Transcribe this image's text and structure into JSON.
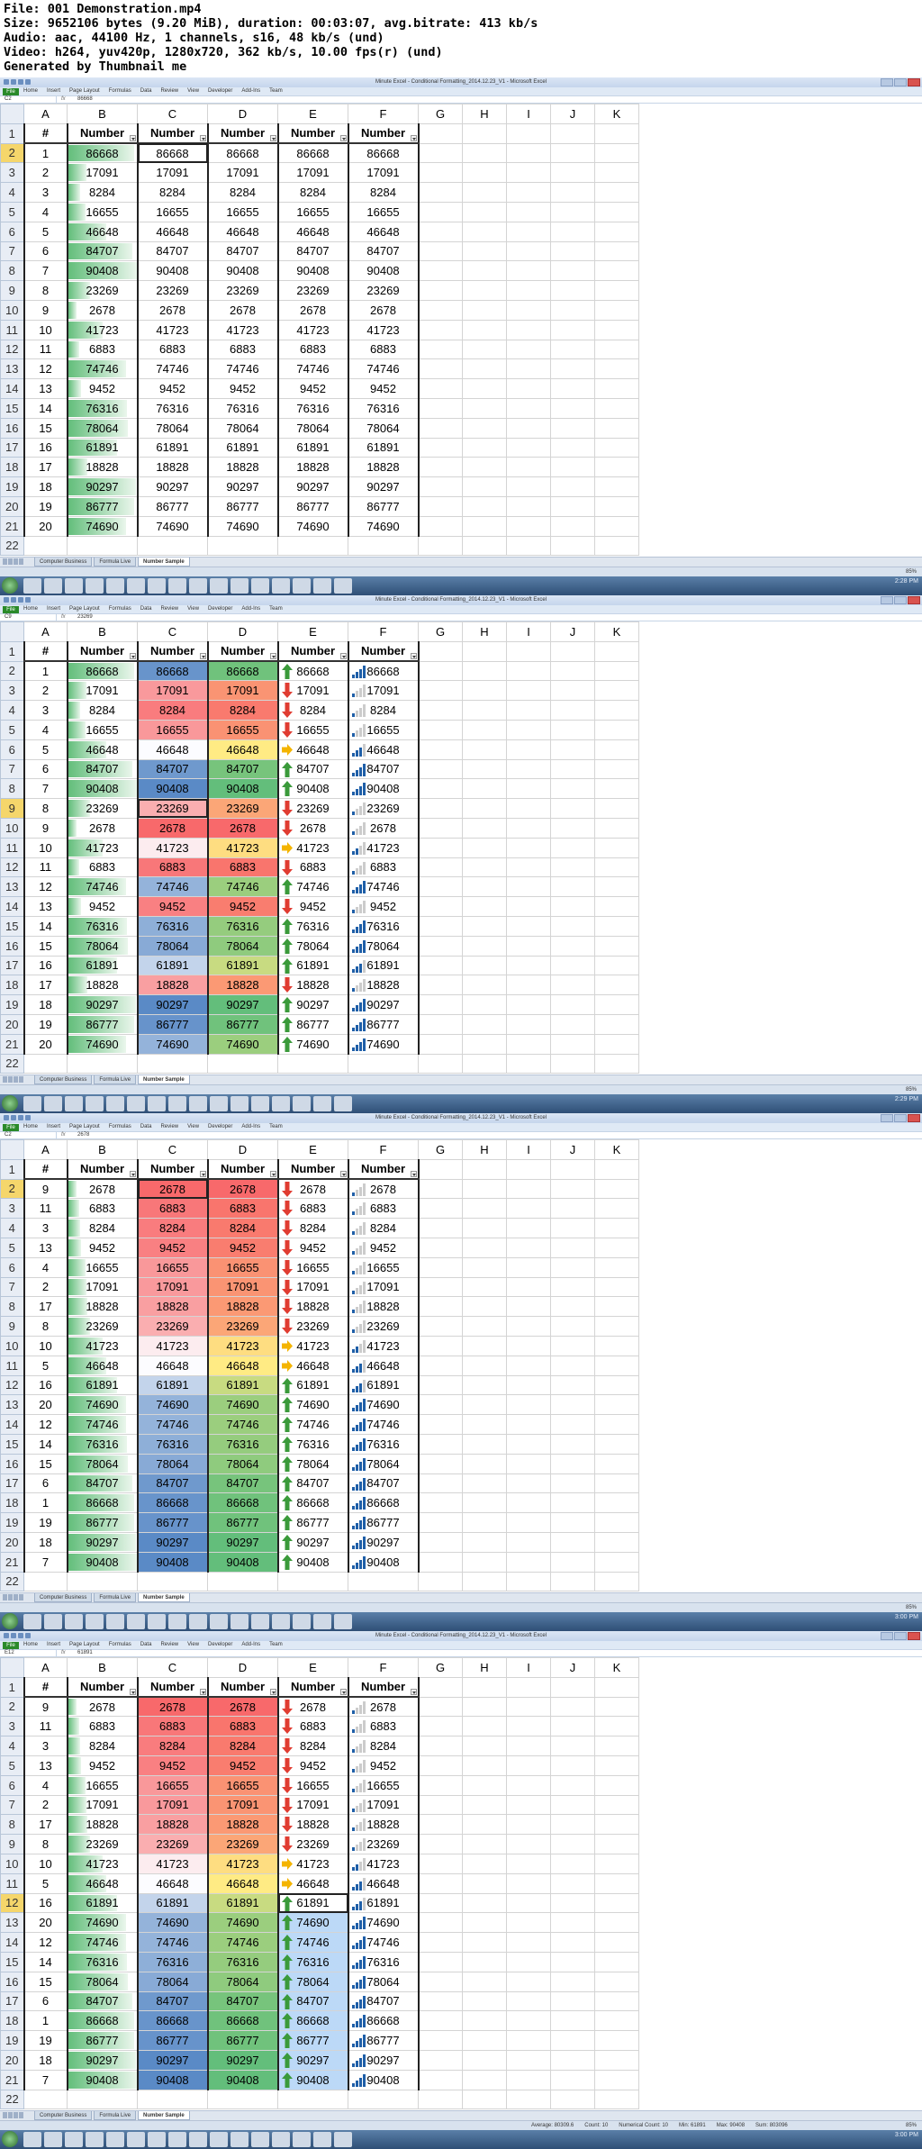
{
  "header": {
    "lines": [
      "File: 001 Demonstration.mp4",
      "Size: 9652106 bytes (9.20 MiB), duration: 00:03:07, avg.bitrate: 413 kb/s",
      "Audio: aac, 44100 Hz, 1 channels, s16, 48 kb/s (und)",
      "Video: h264, yuv420p, 1280x720, 362 kb/s, 10.00 fps(r) (und)",
      "Generated by Thumbnail me"
    ]
  },
  "common": {
    "window_title": "Minute Excel - Conditional Formatting_2014.12.23_V1 - Microsoft Excel",
    "file_tab": "File",
    "ribbon_tabs": [
      "Home",
      "Insert",
      "Page Layout",
      "Formulas",
      "Data",
      "Review",
      "View",
      "Developer",
      "Add-Ins",
      "Team"
    ],
    "fx": "fx",
    "column_letters": [
      "A",
      "B",
      "C",
      "D",
      "E",
      "F",
      "G",
      "H",
      "I",
      "J",
      "K"
    ],
    "row_numbers": [
      "1",
      "2",
      "3",
      "4",
      "5",
      "6",
      "7",
      "8",
      "9",
      "10",
      "11",
      "12",
      "13",
      "14",
      "15",
      "16",
      "17",
      "18",
      "19",
      "20",
      "21",
      "22"
    ],
    "header_hash": "#",
    "header_number": "Number",
    "sheet_tabs": [
      "Computer Business",
      "Formula Live",
      "Number Sample"
    ],
    "active_sheet": "Number Sample",
    "zoom": "85%",
    "colors": {
      "databar": "#63be7b",
      "scale_low": "#f8696b",
      "scale_mid": "#ffeb84",
      "scale_high": "#5a8ac6",
      "arrow_up": "#3a9a3a",
      "arrow_side": "#f4b400",
      "arrow_down": "#e03c31",
      "highlight": "#bcd9f7",
      "selected_header": "#f5d66b"
    }
  },
  "frames": [
    {
      "name_box": "C2",
      "formula": "86668",
      "mode": "plain",
      "active_col": "C",
      "active_row": 2,
      "time": "2:28 PM",
      "status": "",
      "rows": [
        [
          1,
          86668
        ],
        [
          2,
          17091
        ],
        [
          3,
          8284
        ],
        [
          4,
          16655
        ],
        [
          5,
          46648
        ],
        [
          6,
          84707
        ],
        [
          7,
          90408
        ],
        [
          8,
          23269
        ],
        [
          9,
          2678
        ],
        [
          10,
          41723
        ],
        [
          11,
          6883
        ],
        [
          12,
          74746
        ],
        [
          13,
          9452
        ],
        [
          14,
          76316
        ],
        [
          15,
          78064
        ],
        [
          16,
          61891
        ],
        [
          17,
          18828
        ],
        [
          18,
          90297
        ],
        [
          19,
          86777
        ],
        [
          20,
          74690
        ]
      ]
    },
    {
      "name_box": "C9",
      "formula": "23269",
      "mode": "formatted",
      "active_col": "C",
      "active_row": 9,
      "time": "2:29 PM",
      "status": "",
      "rows": [
        [
          1,
          86668
        ],
        [
          2,
          17091
        ],
        [
          3,
          8284
        ],
        [
          4,
          16655
        ],
        [
          5,
          46648
        ],
        [
          6,
          84707
        ],
        [
          7,
          90408
        ],
        [
          8,
          23269
        ],
        [
          9,
          2678
        ],
        [
          10,
          41723
        ],
        [
          11,
          6883
        ],
        [
          12,
          74746
        ],
        [
          13,
          9452
        ],
        [
          14,
          76316
        ],
        [
          15,
          78064
        ],
        [
          16,
          61891
        ],
        [
          17,
          18828
        ],
        [
          18,
          90297
        ],
        [
          19,
          86777
        ],
        [
          20,
          74690
        ]
      ]
    },
    {
      "name_box": "C2",
      "formula": "2678",
      "mode": "formatted",
      "active_col": "C",
      "active_row": 2,
      "time": "3:00 PM",
      "status": "",
      "rows": [
        [
          9,
          2678
        ],
        [
          11,
          6883
        ],
        [
          3,
          8284
        ],
        [
          13,
          9452
        ],
        [
          4,
          16655
        ],
        [
          2,
          17091
        ],
        [
          17,
          18828
        ],
        [
          8,
          23269
        ],
        [
          10,
          41723
        ],
        [
          5,
          46648
        ],
        [
          16,
          61891
        ],
        [
          20,
          74690
        ],
        [
          12,
          74746
        ],
        [
          14,
          76316
        ],
        [
          15,
          78064
        ],
        [
          6,
          84707
        ],
        [
          1,
          86668
        ],
        [
          19,
          86777
        ],
        [
          18,
          90297
        ],
        [
          7,
          90408
        ]
      ]
    },
    {
      "name_box": "E12",
      "formula": "61891",
      "mode": "formatted",
      "active_col": "E",
      "active_row": 12,
      "time": "3:00 PM",
      "status": "Average: 80309.6    Count: 10    Numerical Count: 10    Min: 61891    Max: 90408    Sum: 803096",
      "highlight_rows_from": 13,
      "rows": [
        [
          9,
          2678
        ],
        [
          11,
          6883
        ],
        [
          3,
          8284
        ],
        [
          13,
          9452
        ],
        [
          4,
          16655
        ],
        [
          2,
          17091
        ],
        [
          17,
          18828
        ],
        [
          8,
          23269
        ],
        [
          10,
          41723
        ],
        [
          5,
          46648
        ],
        [
          16,
          61891
        ],
        [
          20,
          74690
        ],
        [
          12,
          74746
        ],
        [
          14,
          76316
        ],
        [
          15,
          78064
        ],
        [
          6,
          84707
        ],
        [
          1,
          86668
        ],
        [
          19,
          86777
        ],
        [
          18,
          90297
        ],
        [
          7,
          90408
        ]
      ]
    }
  ]
}
